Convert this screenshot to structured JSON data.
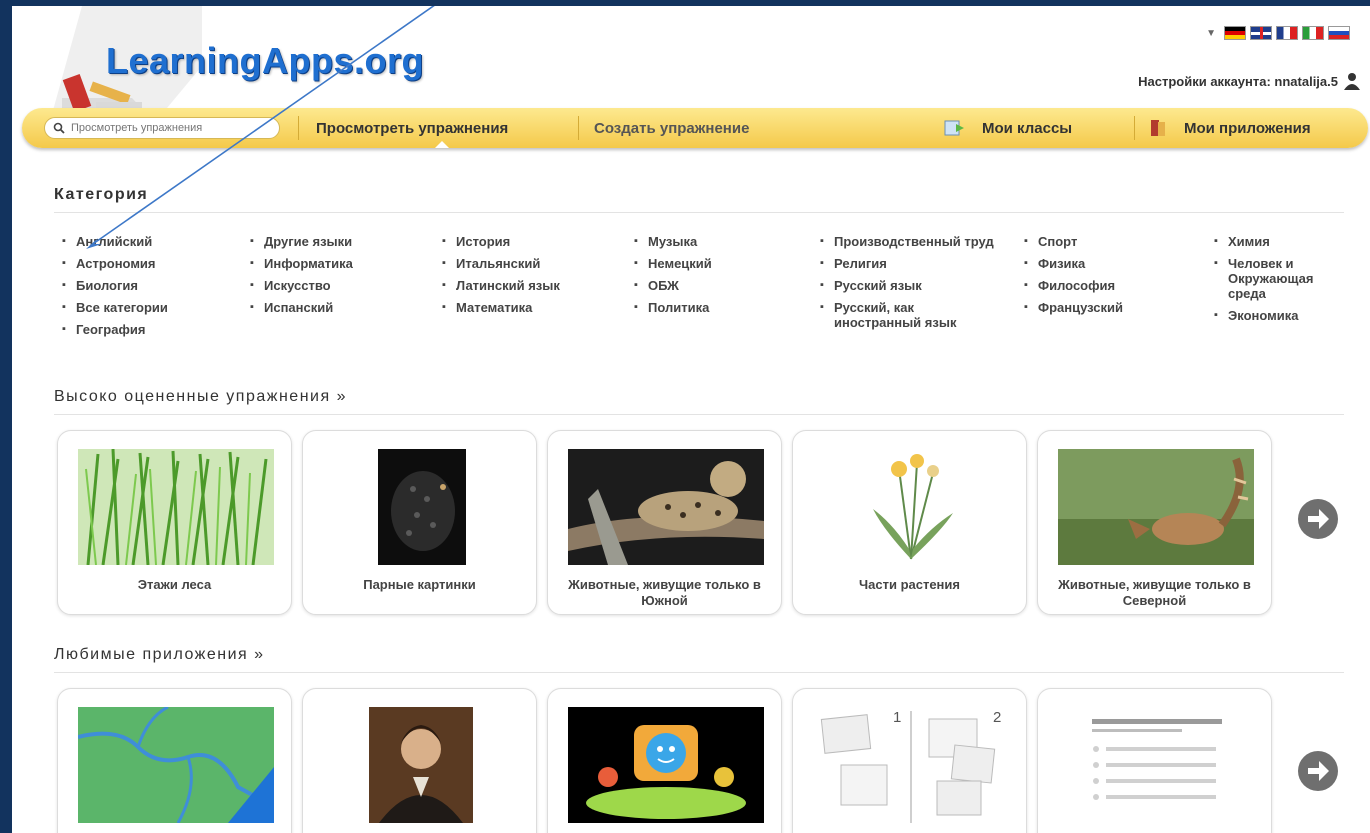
{
  "header": {
    "logo_text": "LearningApps.org",
    "account_label": "Настройки аккаунта: nnatalija.5"
  },
  "languages": [
    "de",
    "gb",
    "fr",
    "it",
    "ru"
  ],
  "nav": {
    "search_placeholder": "Просмотреть упражнения",
    "browse": "Просмотреть упражнения",
    "create": "Создать упражнение",
    "my_classes": "Мои классы",
    "my_apps": "Мои приложения"
  },
  "categories": {
    "title": "Категория",
    "columns": [
      [
        "Английский",
        "Астрономия",
        "Биология",
        "Все категории",
        "География"
      ],
      [
        "Другие языки",
        "Информатика",
        "Искусство",
        "Испанский"
      ],
      [
        "История",
        "Итальянский",
        "Латинский язык",
        "Математика"
      ],
      [
        "Музыка",
        "Немецкий",
        "ОБЖ",
        "Политика"
      ],
      [
        "Производственный труд",
        "Религия",
        "Русский язык",
        "Русский, как иностранный язык"
      ],
      [
        "Спорт",
        "Физика",
        "Философия",
        "Французский"
      ],
      [
        "Химия",
        "Человек и Окружающая среда",
        "Экономика"
      ]
    ]
  },
  "top_rated": {
    "title": "Высоко оцененные упражнения »",
    "cards": [
      {
        "title": "Этажи леса",
        "image": "grass-photo"
      },
      {
        "title": "Парные картинки",
        "image": "hedgehog-photo"
      },
      {
        "title": "Животные, живущие только в Южной",
        "image": "ocelot-photo"
      },
      {
        "title": "Части растения",
        "image": "dandelion-drawing"
      },
      {
        "title": "Животные, живущие только в Северной",
        "image": "coati-photo"
      }
    ]
  },
  "favorite_apps": {
    "title": "Любимые приложения »",
    "cards": [
      {
        "image": "river-map"
      },
      {
        "image": "portrait-painting"
      },
      {
        "image": "cartoon-tv"
      },
      {
        "image": "pair-matching-diagram",
        "label_1": "1",
        "label_2": "2"
      },
      {
        "image": "text-list-diagram"
      }
    ]
  },
  "colors": {
    "frame": "#12335e",
    "navbar": "#f4c94a",
    "logo": "#1f6fd0",
    "arrow": "#3d78c8"
  }
}
